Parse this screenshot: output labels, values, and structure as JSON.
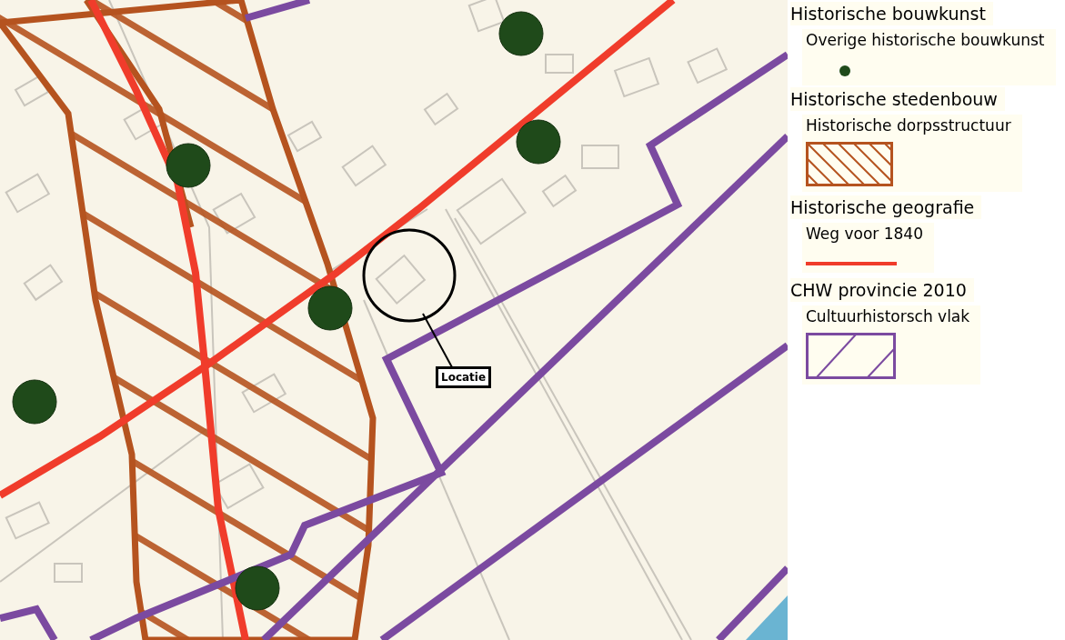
{
  "map": {
    "location_label": "Locatie"
  },
  "legend": [
    {
      "title": "Historische bouwkunst",
      "item": {
        "label": "Overige historische bouwkunst",
        "kind": "point",
        "color": "#1f4a1a"
      }
    },
    {
      "title": "Historische stedenbouw",
      "item": {
        "label": "Historische dorpsstructuur",
        "kind": "hatch",
        "color": "#b5531f"
      }
    },
    {
      "title": "Historische geografie",
      "item": {
        "label": "Weg voor 1840",
        "kind": "line",
        "color": "#f03c2b"
      }
    },
    {
      "title": "CHW provincie 2010",
      "item": {
        "label": "Cultuurhistorsch vlak",
        "kind": "slant",
        "color": "#7b4aa0"
      }
    }
  ]
}
